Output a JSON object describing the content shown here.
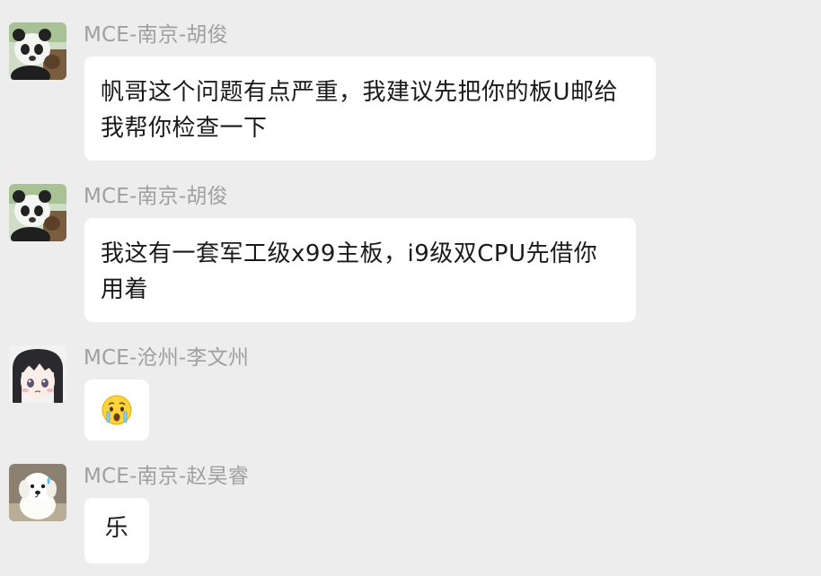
{
  "chat": {
    "messages": [
      {
        "sender": "MCE-南京-胡俊",
        "avatar_icon": "panda-avatar",
        "text": "帆哥这个问题有点严重，我建议先把你的板U邮给我帮你检查一下"
      },
      {
        "sender": "MCE-南京-胡俊",
        "avatar_icon": "panda-avatar",
        "text": "我这有一套军工级x99主板，i9级双CPU先借你用着"
      },
      {
        "sender": "MCE-沧州-李文州",
        "avatar_icon": "anime-girl-avatar",
        "emoji_icon": "shocked-emoji-icon"
      },
      {
        "sender": "MCE-南京-赵昊睿",
        "avatar_icon": "white-dog-avatar",
        "text": "乐"
      }
    ]
  },
  "colors": {
    "background": "#ededed",
    "bubble": "#ffffff",
    "sender_name": "#a0a0a0",
    "message_text": "#1a1a1a"
  }
}
